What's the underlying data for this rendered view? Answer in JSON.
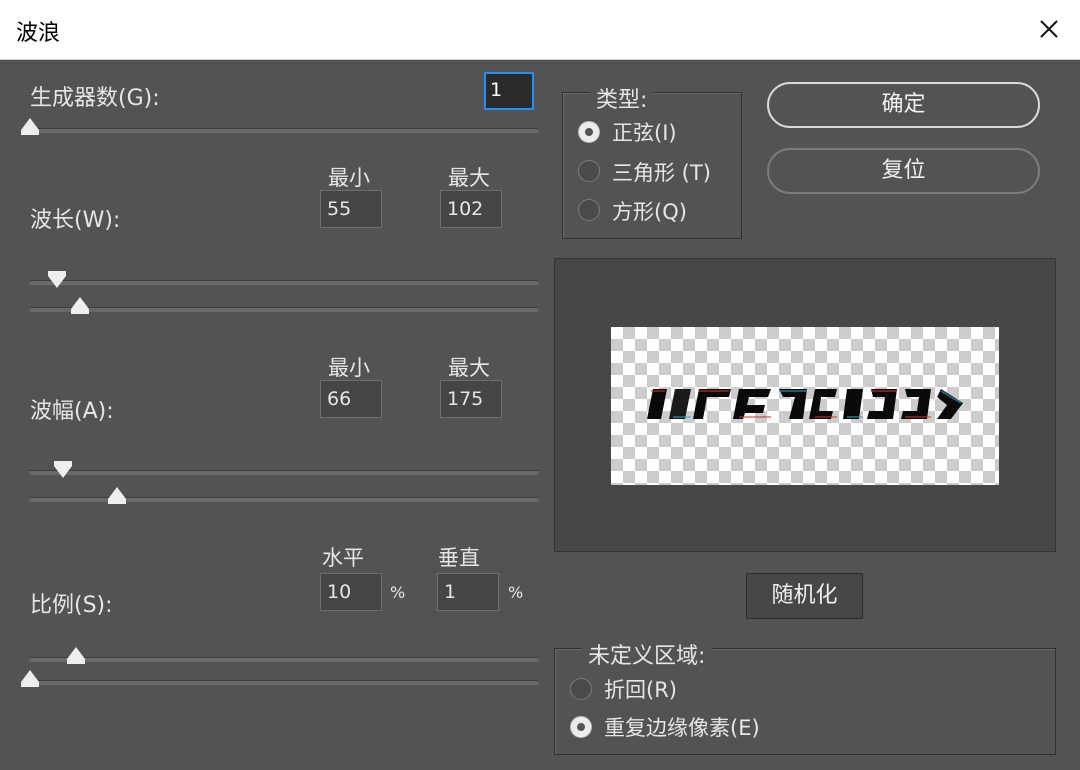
{
  "window": {
    "title": "波浪"
  },
  "generators": {
    "label": "生成器数(G):",
    "value": "1"
  },
  "wavelength": {
    "label": "波长(W):",
    "min_label": "最小",
    "max_label": "最大",
    "min": "55",
    "max": "102"
  },
  "amplitude": {
    "label": "波幅(A):",
    "min_label": "最小",
    "max_label": "最大",
    "min": "66",
    "max": "175"
  },
  "scale": {
    "label": "比例(S):",
    "h_label": "水平",
    "v_label": "垂直",
    "h": "10",
    "v": "1",
    "unit": "%"
  },
  "type": {
    "label": "类型:",
    "options": [
      {
        "label": "正弦(I)",
        "selected": true
      },
      {
        "label": "三角形 (T)",
        "selected": false
      },
      {
        "label": "方形(Q)",
        "selected": false
      }
    ]
  },
  "buttons": {
    "ok": "确定",
    "reset": "复位",
    "randomize": "随机化"
  },
  "undefined_area": {
    "label": "未定义区域:",
    "options": [
      {
        "label": "折回(R)",
        "selected": false
      },
      {
        "label": "重复边缘像素(E)",
        "selected": true
      }
    ]
  }
}
